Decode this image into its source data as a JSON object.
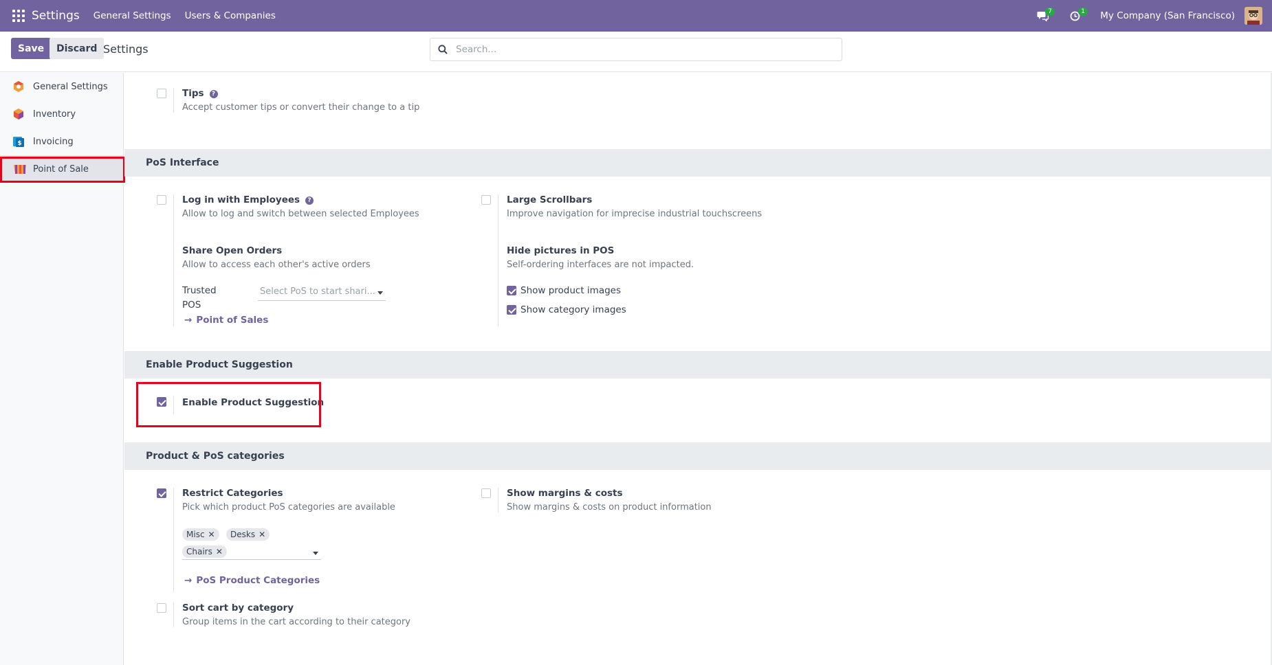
{
  "navbar": {
    "brand": "Settings",
    "menus": [
      "General Settings",
      "Users & Companies"
    ],
    "messages_count": "7",
    "activities_count": "1",
    "company": "My Company (San Francisco)"
  },
  "control_panel": {
    "save_label": "Save",
    "discard_label": "Discard",
    "title": "Settings",
    "search_placeholder": "Search..."
  },
  "sidebar": {
    "items": [
      {
        "label": "General Settings",
        "icon": "general-settings-icon"
      },
      {
        "label": "Inventory",
        "icon": "inventory-icon"
      },
      {
        "label": "Invoicing",
        "icon": "invoicing-icon"
      },
      {
        "label": "Point of Sale",
        "icon": "point-of-sale-icon",
        "active": true
      }
    ]
  },
  "tips": {
    "title": "Tips",
    "desc": "Accept customer tips or convert their change to a tip",
    "checked": false
  },
  "pos_interface": {
    "header": "PoS Interface",
    "login_employees": {
      "title": "Log in with Employees",
      "desc": "Allow to log and switch between selected Employees",
      "checked": false
    },
    "large_scrollbars": {
      "title": "Large Scrollbars",
      "desc": "Improve navigation for imprecise industrial touchscreens",
      "checked": false
    },
    "share_orders": {
      "title": "Share Open Orders",
      "desc": "Allow to access each other's active orders",
      "trusted_label_1": "Trusted",
      "trusted_label_2": "POS",
      "select_placeholder": "Select PoS to start shari...",
      "link": "Point of Sales"
    },
    "hide_pictures": {
      "title": "Hide pictures in POS",
      "desc": "Self-ordering interfaces are not impacted.",
      "show_product_images": "Show product images",
      "show_category_images": "Show category images"
    }
  },
  "product_suggestion": {
    "header": "Enable Product Suggestion",
    "title": "Enable Product Suggestion",
    "checked": true
  },
  "categories": {
    "header": "Product & PoS categories",
    "restrict": {
      "title": "Restrict Categories",
      "desc": "Pick which product PoS categories are available",
      "checked": true,
      "tags": [
        "Misc",
        "Desks",
        "Chairs"
      ],
      "link": "PoS Product Categories"
    },
    "margins": {
      "title": "Show margins & costs",
      "desc": "Show margins & costs on product information",
      "checked": false
    },
    "sort_cart": {
      "title": "Sort cart by category",
      "desc": "Group items in the cart according to their category",
      "checked": false
    }
  },
  "colors": {
    "brand": "#71639e",
    "highlight": "#e8001c",
    "badge": "#28a745"
  }
}
